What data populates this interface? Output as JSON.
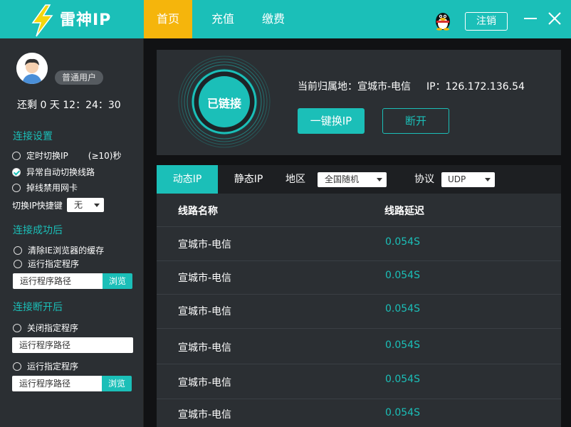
{
  "app": {
    "title": "雷神IP"
  },
  "nav": [
    {
      "label": "首页",
      "active": true
    },
    {
      "label": "充值",
      "active": false
    },
    {
      "label": "缴费",
      "active": false
    }
  ],
  "header": {
    "logout_label": "注销"
  },
  "user": {
    "badge": "普通用户",
    "remaining": "还剩 0 天 12：24：30"
  },
  "connect_settings": {
    "title": "连接设置",
    "timed_switch": "定时切换IP",
    "timed_hint": "(≥10)秒",
    "auto_switch": "异常自动切换线路",
    "disable_nic": "掉线禁用网卡",
    "hotkey_label": "切换IP快捷键",
    "hotkey_value": "无"
  },
  "on_success": {
    "title": "连接成功后",
    "clear_cache": "清除IE浏览器的缓存",
    "run_program": "运行指定程序",
    "path_placeholder": "运行程序路径",
    "browse_label": "浏览"
  },
  "on_disconnect": {
    "title": "连接断开后",
    "close_program": "关闭指定程序",
    "close_path_placeholder": "运行程序路径",
    "run_program": "运行指定程序",
    "run_path_placeholder": "运行程序路径",
    "browse_label": "浏览"
  },
  "status": {
    "connected_label": "已链接",
    "location": "当前归属地：宣城市-电信",
    "ip": "IP：126.172.136.54",
    "switch_label": "一键换IP",
    "disconnect_label": "断开"
  },
  "list": {
    "tabs": [
      {
        "label": "动态IP",
        "active": true
      },
      {
        "label": "静态IP",
        "active": false
      }
    ],
    "region_label": "地区",
    "region_value": "全国随机",
    "protocol_label": "协议",
    "protocol_value": "UDP",
    "columns": [
      "线路名称",
      "线路延迟"
    ],
    "rows": [
      {
        "name": "宣城市-电信",
        "delay": "0.054S"
      },
      {
        "name": "宣城市-电信",
        "delay": "0.054S"
      },
      {
        "name": "宣城市-电信",
        "delay": "0.054S"
      },
      {
        "name": "宣城市-电信",
        "delay": "0.054S"
      },
      {
        "name": "宣城市-电信",
        "delay": "0.054S"
      },
      {
        "name": "宣城市-电信",
        "delay": "0.054S"
      }
    ]
  },
  "colors": {
    "accent": "#1bbfb8",
    "nav_active": "#f5b50c",
    "panel": "#2b2f33",
    "background": "#111214"
  }
}
